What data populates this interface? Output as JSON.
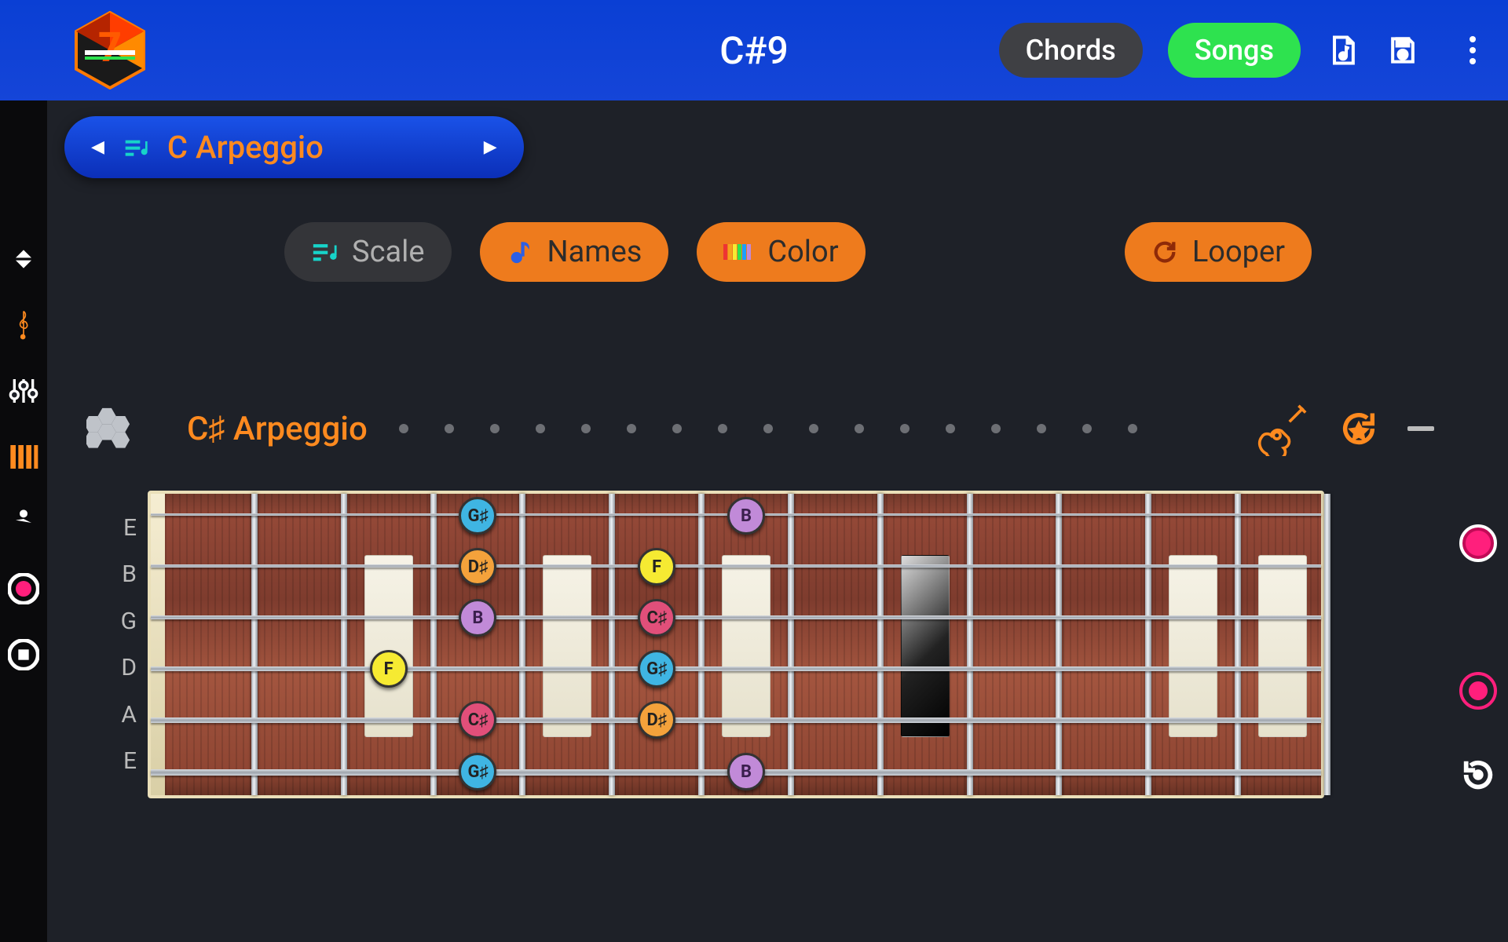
{
  "header": {
    "title": "C#9",
    "chords_label": "Chords",
    "songs_label": "Songs"
  },
  "selector": {
    "label": "C Arpeggio"
  },
  "modes": {
    "scale": "Scale",
    "names": "Names",
    "color": "Color",
    "looper": "Looper"
  },
  "fb": {
    "title": "C♯ Arpeggio",
    "strings": [
      "E",
      "B",
      "G",
      "D",
      "A",
      "E"
    ],
    "notes": [
      {
        "string": 0,
        "fret": 4,
        "label": "G♯",
        "color": "cyan"
      },
      {
        "string": 0,
        "fret": 7,
        "label": "B",
        "color": "purple"
      },
      {
        "string": 1,
        "fret": 4,
        "label": "D♯",
        "color": "orange"
      },
      {
        "string": 1,
        "fret": 6,
        "label": "F",
        "color": "yellow"
      },
      {
        "string": 2,
        "fret": 4,
        "label": "B",
        "color": "purple"
      },
      {
        "string": 2,
        "fret": 6,
        "label": "C♯",
        "color": "pink"
      },
      {
        "string": 3,
        "fret": 3,
        "label": "F",
        "color": "yellow"
      },
      {
        "string": 3,
        "fret": 6,
        "label": "G♯",
        "color": "cyan"
      },
      {
        "string": 4,
        "fret": 4,
        "label": "C♯",
        "color": "pink"
      },
      {
        "string": 4,
        "fret": 6,
        "label": "D♯",
        "color": "orange"
      },
      {
        "string": 5,
        "fret": 4,
        "label": "G♯",
        "color": "cyan"
      },
      {
        "string": 5,
        "fret": 7,
        "label": "B",
        "color": "purple"
      }
    ]
  }
}
